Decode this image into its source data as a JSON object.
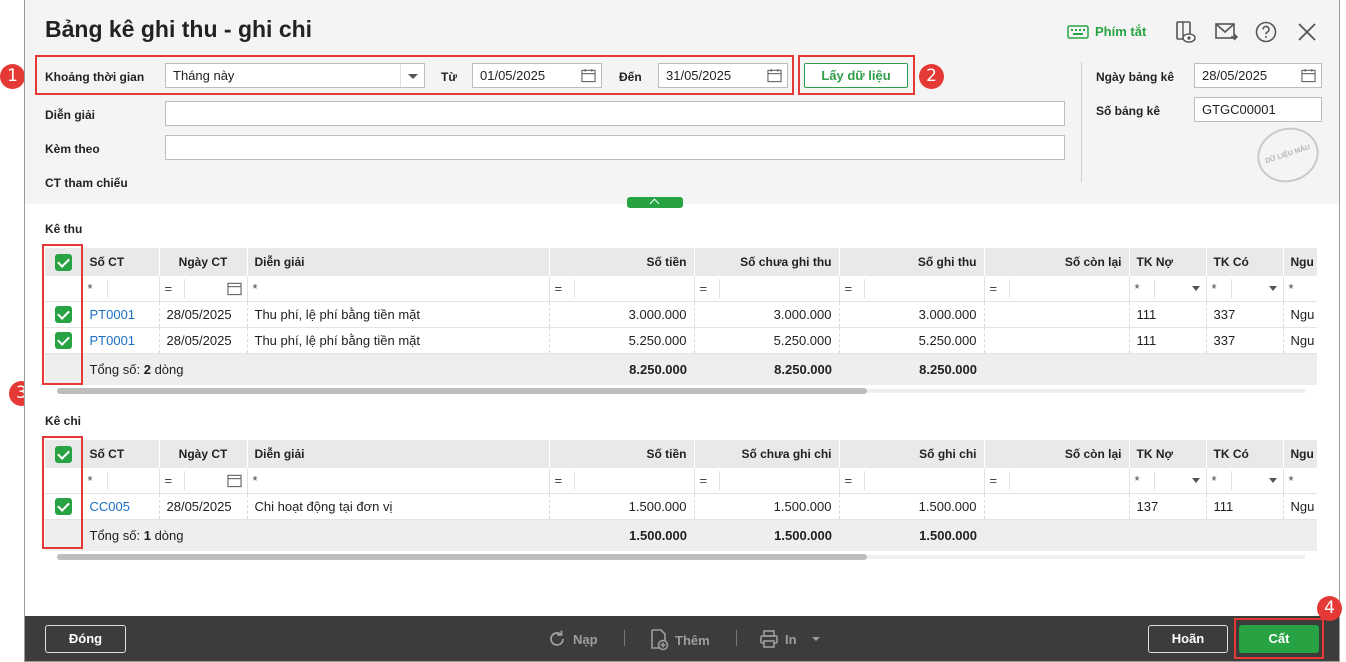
{
  "window": {
    "title": "Bảng kê ghi thu - ghi chi"
  },
  "toolbar": {
    "shortcut_label": "Phím tắt"
  },
  "filter": {
    "period_label": "Khoảng thời gian",
    "period_value": "Tháng này",
    "from_label": "Từ",
    "from_value": "01/05/2025",
    "to_label": "Đến",
    "to_value": "31/05/2025",
    "get_data_label": "Lấy dữ liệu"
  },
  "form": {
    "description_label": "Diễn giải",
    "description_value": "",
    "attach_label": "Kèm theo",
    "attach_value": "",
    "ref_label": "CT tham chiếu",
    "date_label": "Ngày bảng kê",
    "date_value": "28/05/2025",
    "number_label": "Số bảng kê",
    "number_value": "GTGC00001",
    "stamp_text": "DỮ LIỆU MẪU"
  },
  "badges": [
    "1",
    "2",
    "3",
    "4"
  ],
  "income": {
    "section_label": "Kê thu",
    "columns": [
      "Số CT",
      "Ngày CT",
      "Diễn giải",
      "Số tiền",
      "Số chưa ghi thu",
      "Số ghi thu",
      "Số còn lại",
      "TK Nợ",
      "TK Có",
      "Ngu"
    ],
    "filters": {
      "star": "*",
      "eq": "="
    },
    "rows": [
      {
        "no": "PT0001",
        "date": "28/05/2025",
        "desc": "Thu phí, lệ phí bằng tiền mặt",
        "amount": "3.000.000",
        "pending": "3.000.000",
        "recorded": "3.000.000",
        "remain": "",
        "debit": "111",
        "credit": "337",
        "src": "Ngu"
      },
      {
        "no": "PT0001",
        "date": "28/05/2025",
        "desc": "Thu phí, lệ phí bằng tiền mặt",
        "amount": "5.250.000",
        "pending": "5.250.000",
        "recorded": "5.250.000",
        "remain": "",
        "debit": "111",
        "credit": "337",
        "src": "Ngu"
      }
    ],
    "total_prefix": "Tổng số:",
    "total_count": "2",
    "total_suffix": "dòng",
    "total_amount": "8.250.000",
    "total_pending": "8.250.000",
    "total_recorded": "8.250.000"
  },
  "expense": {
    "section_label": "Kê chi",
    "columns": [
      "Số CT",
      "Ngày CT",
      "Diễn giải",
      "Số tiền",
      "Số chưa ghi chi",
      "Số ghi chi",
      "Số còn lại",
      "TK Nợ",
      "TK Có",
      "Ngu"
    ],
    "rows": [
      {
        "no": "CC005",
        "date": "28/05/2025",
        "desc": "Chi hoạt động tại đơn vị",
        "amount": "1.500.000",
        "pending": "1.500.000",
        "recorded": "1.500.000",
        "remain": "",
        "debit": "137",
        "credit": "111",
        "src": "Ngu"
      }
    ],
    "total_prefix": "Tổng số:",
    "total_count": "1",
    "total_suffix": "dòng",
    "total_amount": "1.500.000",
    "total_pending": "1.500.000",
    "total_recorded": "1.500.000"
  },
  "footer": {
    "close_label": "Đóng",
    "reload_label": "Nạp",
    "add_label": "Thêm",
    "print_label": "In",
    "cancel_label": "Hoãn",
    "save_label": "Cất"
  },
  "colors": {
    "accent": "#27a343",
    "highlight": "#e53935",
    "footer_bg": "#3c3c3c"
  }
}
